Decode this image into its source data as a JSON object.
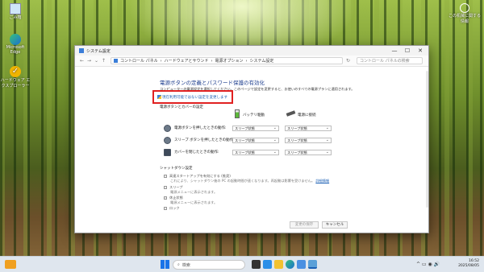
{
  "desktop": {
    "icons": [
      {
        "label": "ごみ箱",
        "icon": "recycle-bin-icon"
      },
      {
        "label": "Microsoft Edge",
        "icon": "edge-icon"
      },
      {
        "label": "ハードウェア エクスプローラー",
        "icon": "checkmark-icon"
      }
    ],
    "top_right_icon_label": "この机械に関する情報"
  },
  "window": {
    "title": "システム設定",
    "controls": {
      "minimize": "—",
      "maximize": "☐",
      "close": "✕"
    },
    "breadcrumb": [
      "コントロール パネル",
      "ハードウェアとサウンド",
      "電源オプション",
      "システム設定"
    ],
    "search_placeholder": "コントロール パネルの検索",
    "heading": "電源ボタンの定義とパスワード保護の有効化",
    "intro": "コンピューターの電源設定を選択してください。このページで設定を変更すると、お使いのすべての電源プランに適用されます。",
    "change_link": "現在利用可能ではない設定を変更します",
    "section_title": "電源ボタンとカバーの設定",
    "columns": {
      "battery": "バッテリ駆動",
      "plugged": "電源に接続"
    },
    "rows": [
      {
        "label": "電源ボタンを押したときの動作:",
        "battery": "スリープ状態",
        "plugged": "スリープ状態",
        "icon": "power-button-icon"
      },
      {
        "label": "スリープ ボタンを押したときの動作:",
        "battery": "スリープ状態",
        "plugged": "スリープ状態",
        "icon": "sleep-button-icon"
      },
      {
        "label": "カバーを閉じたときの動作:",
        "battery": "スリープ状態",
        "plugged": "スリープ状態",
        "icon": "laptop-lid-icon"
      }
    ],
    "shutdown": {
      "title": "シャットダウン設定",
      "fast_startup": "高速スタートアップを有効にする (推奨)",
      "fast_startup_desc": "これにより、シャットダウン後の PC の起動時間が速くなります。再起動は影響を受けません。",
      "fast_startup_link": "詳細情報",
      "sleep": "スリープ",
      "sleep_desc": "電源メニューに表示されます。",
      "hibernate": "休止状態",
      "hibernate_desc": "電源メニューに表示されます。",
      "lock": "ロック"
    },
    "buttons": {
      "save": "変更の保存",
      "cancel": "キャンセル"
    }
  },
  "taskbar": {
    "search_label": "検索",
    "time": "16:52",
    "date": "2025/08/05"
  }
}
